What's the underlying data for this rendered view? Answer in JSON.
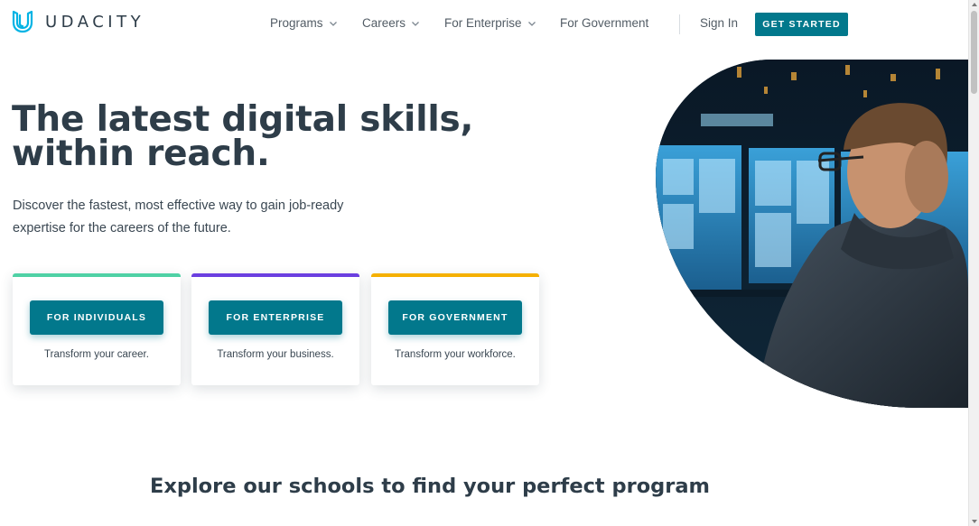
{
  "brand": {
    "name": "UDACITY",
    "color": "#02b3e4"
  },
  "nav": {
    "items": [
      {
        "label": "Programs",
        "has_dropdown": true
      },
      {
        "label": "Careers",
        "has_dropdown": true
      },
      {
        "label": "For Enterprise",
        "has_dropdown": true
      },
      {
        "label": "For Government",
        "has_dropdown": false
      }
    ],
    "sign_in": "Sign In",
    "get_started": "GET STARTED"
  },
  "hero": {
    "title_line1": "The latest digital skills,",
    "title_line2": "within reach.",
    "subtitle": "Discover the fastest, most effective way to gain job-ready expertise for the careers of the future."
  },
  "cards": [
    {
      "button": "FOR INDIVIDUALS",
      "description": "Transform your career.",
      "accent": "#4fd1a5"
    },
    {
      "button": "FOR ENTERPRISE",
      "description": "Transform your business.",
      "accent": "#6b3fe0"
    },
    {
      "button": "FOR GOVERNMENT",
      "description": "Transform your workforce.",
      "accent": "#f5b000"
    }
  ],
  "section": {
    "heading": "Explore our schools to find your perfect program"
  },
  "colors": {
    "primary": "#02788c",
    "text": "#2e3d49",
    "muted": "#525c65"
  }
}
